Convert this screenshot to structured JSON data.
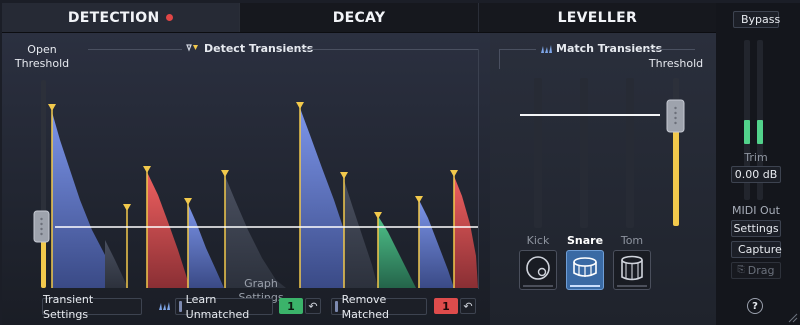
{
  "tabs": [
    {
      "label": "DETECTION",
      "active": true
    },
    {
      "label": "DECAY",
      "active": false
    },
    {
      "label": "LEVELLER",
      "active": false
    }
  ],
  "detection": {
    "open_threshold_label": "Open\nThreshold",
    "detect_transients_label": "Detect Transients",
    "graph_settings_label": "Graph Settings",
    "transient_settings_label": "Transient Settings",
    "learn_unmatched_label": "Learn Unmatched",
    "learn_unmatched_count": "1",
    "remove_matched_label": "Remove Matched",
    "remove_matched_count": "1",
    "colors": {
      "blue": "#5b73c4",
      "red": "#d24a4a",
      "green": "#3c9a66",
      "marker": "#f2c94c",
      "threshold": "#ffffff"
    }
  },
  "match": {
    "title": "Match Transients",
    "threshold_label": "Threshold",
    "drums": [
      {
        "label": "Kick",
        "active": false,
        "icon": "kick-drum-icon"
      },
      {
        "label": "Snare",
        "active": true,
        "icon": "snare-drum-icon"
      },
      {
        "label": "Tom",
        "active": false,
        "icon": "tom-drum-icon"
      }
    ]
  },
  "right": {
    "bypass_label": "Bypass",
    "trim_label": "Trim",
    "trim_value": "0.00 dB",
    "midi_out_label": "MIDI Out",
    "settings_label": "Settings",
    "capture_label": "Capture",
    "drag_label": "Drag",
    "help_label": "?"
  }
}
